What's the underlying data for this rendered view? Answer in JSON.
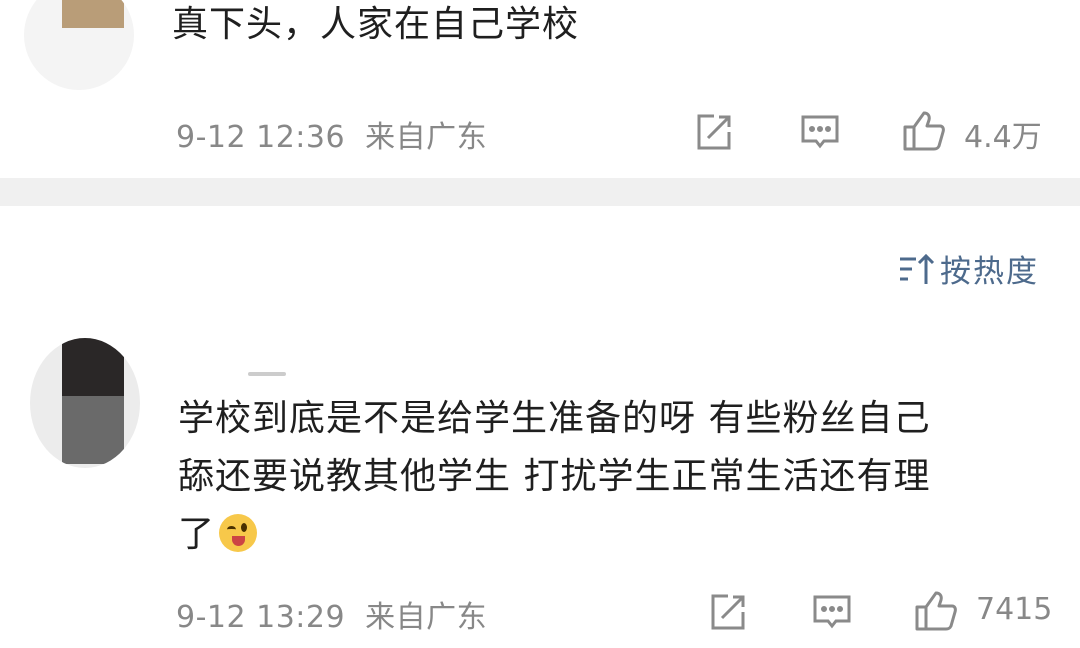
{
  "comment1": {
    "text": "真下头，人家在自己学校",
    "time": "9-12 12:36",
    "location": "来自广东",
    "likes": "4.4万"
  },
  "sort": {
    "label": "按热度"
  },
  "comment2": {
    "line1": "学校到底是不是给学生准备的呀 有些粉丝自己",
    "line2": "舔还要说教其他学生 打扰学生正常生活还有理",
    "line3": "了",
    "time": "9-12 13:29",
    "location": "来自广东",
    "likes": "7415"
  },
  "icons": {
    "share": "share-icon",
    "comment": "comment-icon",
    "like": "thumbs-up-icon",
    "sort": "sort-icon",
    "emoji": "tongue-wink-emoji"
  },
  "colors": {
    "text": "#1f1f1f",
    "meta": "#888888",
    "sort": "#4d6a8c",
    "divider": "#f0f0f0"
  }
}
